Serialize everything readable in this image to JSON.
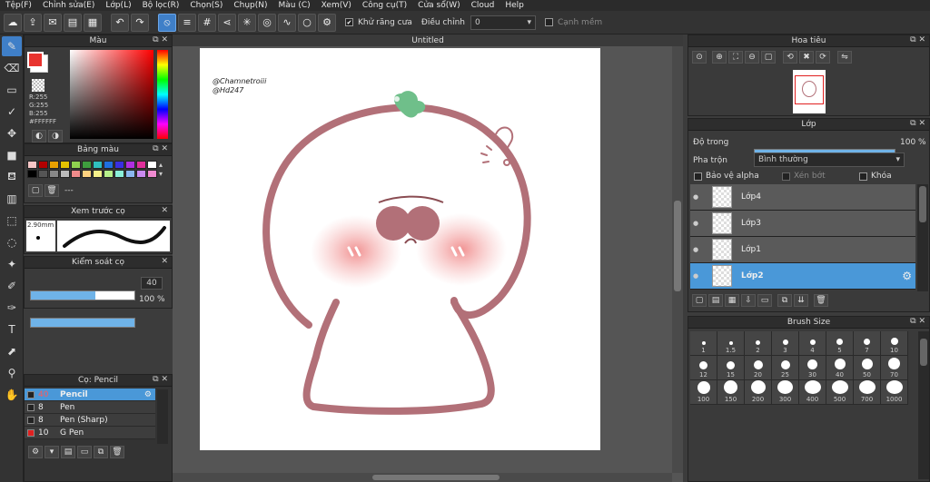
{
  "menu": [
    "Tệp(F)",
    "Chỉnh sửa(E)",
    "Lớp(L)",
    "Bộ lọc(R)",
    "Chọn(S)",
    "Chụp(N)",
    "Màu (C)",
    "Xem(V)",
    "Công cụ(T)",
    "Cửa sổ(W)",
    "Cloud",
    "Help"
  ],
  "toolbar": {
    "antialias_label": "Khử răng cưa",
    "adjust_label": "Điều chỉnh",
    "adjust_value": "0",
    "edge_label": "Cạnh mềm"
  },
  "color_panel": {
    "title": "Màu",
    "r": "R:255",
    "g": "G:255",
    "b": "B:255",
    "hex": "#FFFFFF",
    "foreground": "#e8332e",
    "background": "#ffffff"
  },
  "palette_panel": {
    "title": "Bảng màu",
    "more": "---",
    "swatches": [
      "#f7c6c6",
      "#b30000",
      "#e8a000",
      "#e3c200",
      "#8fd14f",
      "#3e9c3e",
      "#2fbfbf",
      "#1f6fe0",
      "#3a2fe0",
      "#b02fe0",
      "#e02f9a",
      "#ffffff",
      "#000000",
      "#555555",
      "#888888",
      "#bbbbbb",
      "#f08a8a",
      "#ffd27f",
      "#f6f08a",
      "#b7f08a",
      "#8af0d9",
      "#8ab7f0",
      "#c98af0",
      "#f08ad0"
    ]
  },
  "preview_panel": {
    "title": "Xem trước cọ",
    "size": "2.90mm"
  },
  "brush_control": {
    "title": "Kiểm soát cọ",
    "size_value": "40",
    "size_fill": 0.62,
    "opacity_value": "100 %",
    "opacity_fill": 1.0
  },
  "brush_list": {
    "title": "Cọ: Pencil",
    "items": [
      {
        "size": "40",
        "name": "Pencil",
        "selected": true
      },
      {
        "size": "8",
        "name": "Pen",
        "selected": false
      },
      {
        "size": "8",
        "name": "Pen (Sharp)",
        "selected": false
      },
      {
        "size": "10",
        "name": "G Pen",
        "selected": false
      }
    ]
  },
  "canvas": {
    "tab_title": "Untitled",
    "watermark_line1": "@Chamnetroiii",
    "watermark_line2": "@Hd247"
  },
  "navigator": {
    "title": "Hoa tiêu"
  },
  "layer_panel": {
    "title": "Lớp",
    "opacity_label": "Độ trong",
    "opacity_value": "100 %",
    "opacity_fill": 1.0,
    "blend_label": "Pha trộn",
    "blend_value": "Bình thường",
    "protect_alpha": "Bảo vệ alpha",
    "clip": "Xén bớt",
    "lock": "Khóa",
    "layers": [
      {
        "name": "Lớp4",
        "selected": false
      },
      {
        "name": "Lớp3",
        "selected": false
      },
      {
        "name": "Lớp1",
        "selected": false
      },
      {
        "name": "Lớp2",
        "selected": true
      }
    ]
  },
  "brush_size_panel": {
    "title": "Brush Size",
    "sizes": [
      "1",
      "1.5",
      "2",
      "3",
      "4",
      "5",
      "7",
      "10",
      "12",
      "15",
      "20",
      "25",
      "30",
      "40",
      "50",
      "70",
      "100",
      "150",
      "200",
      "300",
      "400",
      "500",
      "700",
      "1000"
    ]
  }
}
